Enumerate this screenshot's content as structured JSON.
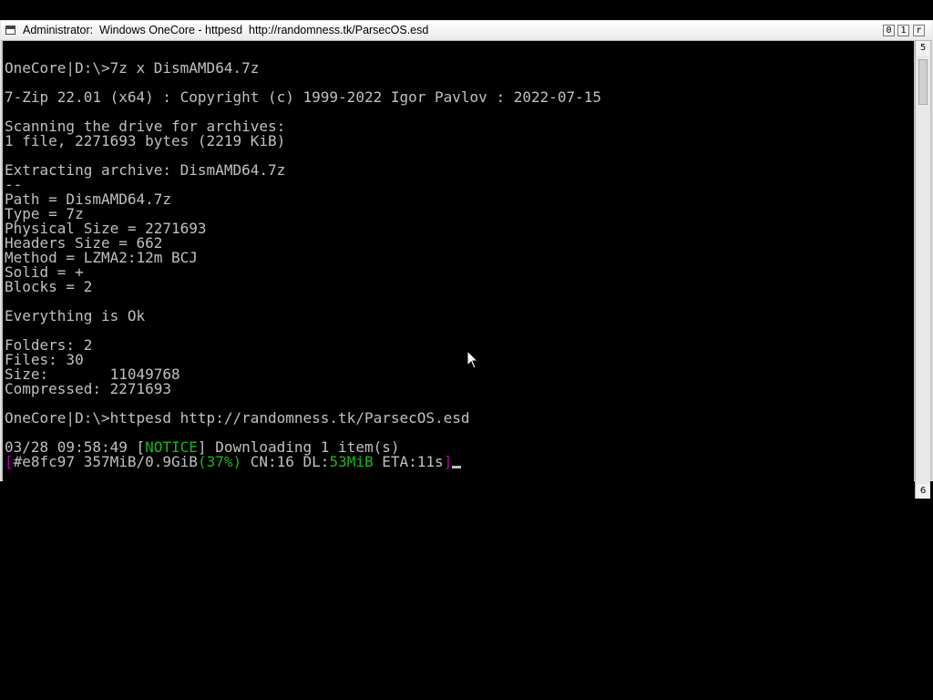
{
  "window": {
    "title": "Administrator:  Windows OneCore - httpesd  http://randomness.tk/ParsecOS.esd",
    "buttons": {
      "minimize": "0",
      "maximize": "1",
      "close": "r"
    }
  },
  "scrollbar": {
    "up_arrow": "5",
    "down_arrow": "6"
  },
  "console": {
    "lines": [
      "OneCore|D:\\>7z x DismAMD64.7z",
      "",
      "7-Zip 22.01 (x64) : Copyright (c) 1999-2022 Igor Pavlov : 2022-07-15",
      "",
      "Scanning the drive for archives:",
      "1 file, 2271693 bytes (2219 KiB)",
      "",
      "Extracting archive: DismAMD64.7z",
      "--",
      "Path = DismAMD64.7z",
      "Type = 7z",
      "Physical Size = 2271693",
      "Headers Size = 662",
      "Method = LZMA2:12m BCJ",
      "Solid = +",
      "Blocks = 2",
      "",
      "Everything is Ok",
      "",
      "Folders: 2",
      "Files: 30",
      "Size:       11049768",
      "Compressed: 2271693",
      "",
      "OneCore|D:\\>httpesd http://randomness.tk/ParsecOS.esd",
      ""
    ],
    "notice_line": {
      "prefix": "03/28 09:58:49 [",
      "tag": "NOTICE",
      "suffix": "] Downloading 1 item(s)"
    },
    "progress_line": {
      "open_bracket": "[",
      "stats": "#e8fc97 357MiB/0.9GiB",
      "percent": "(37%)",
      "connections": " CN:16 DL:",
      "speed": "53MiB",
      "eta": " ETA:11s",
      "close_bracket": "]"
    },
    "progress_fraction": 0.37
  },
  "colors": {
    "console_bg": "#000000",
    "console_fg": "#c0c0c0",
    "notice_green": "#18b818",
    "bracket_magenta": "#b000b0",
    "titlebar_bg": "#f0f0f0"
  }
}
